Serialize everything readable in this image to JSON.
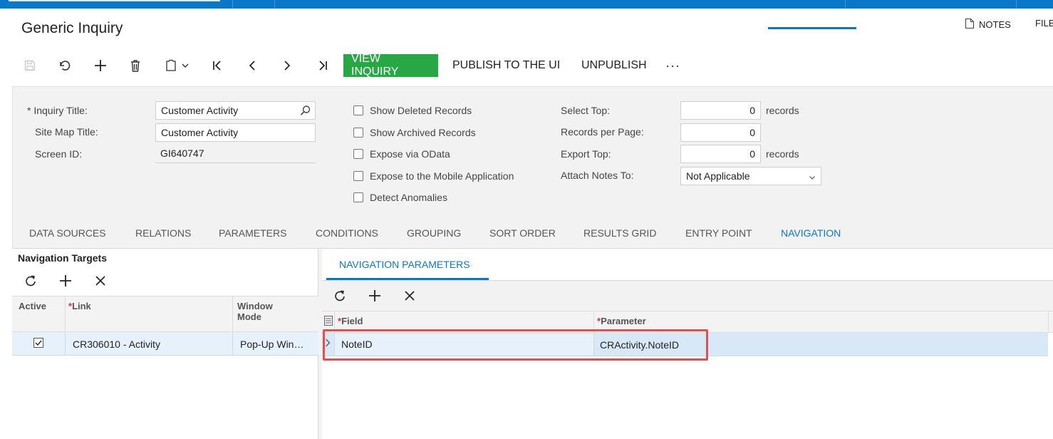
{
  "header": {
    "title": "Generic Inquiry",
    "notes_label": "NOTES",
    "files_label": "FILE"
  },
  "toolbar": {
    "save_icon": "save-icon",
    "undo_icon": "undo-icon",
    "add_icon": "plus-icon",
    "delete_icon": "trash-icon",
    "copy_icon": "clipboard-icon",
    "first_icon": "first-page-icon",
    "prev_icon": "chevron-left-icon",
    "next_icon": "chevron-right-icon",
    "last_icon": "last-page-icon",
    "view_inquiry": "VIEW INQUIRY",
    "publish": "PUBLISH TO THE UI",
    "unpublish": "UNPUBLISH",
    "more": "···",
    "primary_color": "#28a745"
  },
  "form": {
    "inquiry_title_label": "Inquiry Title:",
    "inquiry_title_required": "*",
    "inquiry_title_value": "Customer Activity",
    "site_map_title_label": "Site Map Title:",
    "site_map_title_value": "Customer Activity",
    "screen_id_label": "Screen ID:",
    "screen_id_value": "GI640747",
    "checkboxes": [
      {
        "label": "Show Deleted Records",
        "checked": false
      },
      {
        "label": "Show Archived Records",
        "checked": false
      },
      {
        "label": "Expose via OData",
        "checked": false
      },
      {
        "label": "Expose to the Mobile Application",
        "checked": false
      },
      {
        "label": "Detect Anomalies",
        "checked": false
      }
    ],
    "select_top_label": "Select Top:",
    "select_top_value": "0",
    "records_per_page_label": "Records per Page:",
    "records_per_page_value": "0",
    "export_top_label": "Export Top:",
    "export_top_value": "0",
    "records_suffix": "records",
    "attach_notes_label": "Attach Notes To:",
    "attach_notes_value": "Not Applicable"
  },
  "tabs": [
    "DATA SOURCES",
    "RELATIONS",
    "PARAMETERS",
    "CONDITIONS",
    "GROUPING",
    "SORT ORDER",
    "RESULTS GRID",
    "ENTRY POINT",
    "NAVIGATION"
  ],
  "active_tab": "NAVIGATION",
  "navigation_targets": {
    "title": "Navigation Targets",
    "columns": [
      "Active",
      "Link",
      "Window",
      "Mode"
    ],
    "link_required": "*",
    "rows": [
      {
        "active": true,
        "link": "CR306010 - Activity",
        "window_mode": "Pop-Up Win…"
      }
    ]
  },
  "navigation_parameters": {
    "tab_label": "NAVIGATION PARAMETERS",
    "columns": [
      "Field",
      "Parameter"
    ],
    "required": "*",
    "rows": [
      {
        "field": "NoteID",
        "parameter": "CRActivity.NoteID"
      }
    ]
  },
  "colors": {
    "topbar": "#0978c9",
    "accent": "#0a78c8",
    "highlight": "#e05050",
    "selected_row": "#e6f1fb"
  }
}
